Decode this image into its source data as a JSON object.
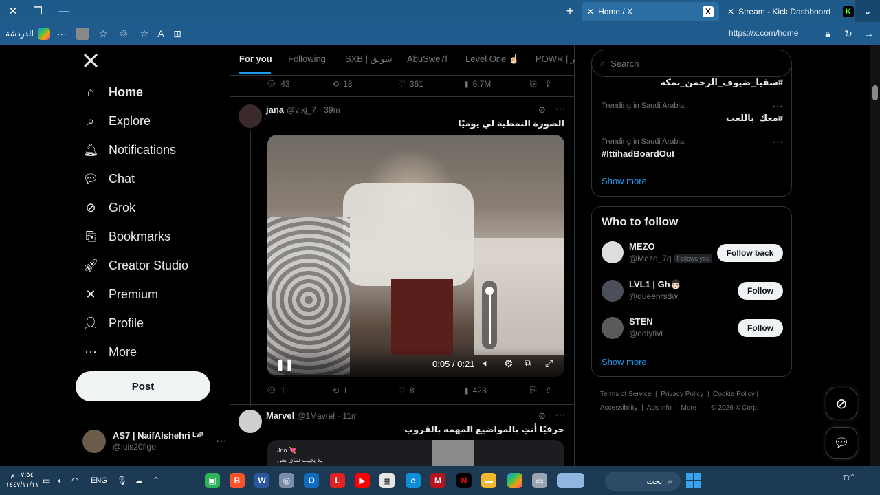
{
  "browser": {
    "tabs": [
      {
        "title": "Home / X",
        "active": true
      },
      {
        "title": "Stream - Kick Dashboard",
        "active": false
      }
    ],
    "address": "https://x.com/home",
    "copilot_label": "الدردشة"
  },
  "sidebar": {
    "nav": [
      {
        "label": "Home",
        "icon": "home-icon"
      },
      {
        "label": "Explore",
        "icon": "search-icon"
      },
      {
        "label": "Notifications",
        "icon": "bell-icon"
      },
      {
        "label": "Chat",
        "icon": "chat-icon"
      },
      {
        "label": "Grok",
        "icon": "grok-icon"
      },
      {
        "label": "Bookmarks",
        "icon": "bookmark-icon"
      },
      {
        "label": "Creator Studio",
        "icon": "rocket-icon"
      },
      {
        "label": "Premium",
        "icon": "x-logo-icon"
      },
      {
        "label": "Profile",
        "icon": "person-icon"
      },
      {
        "label": "More",
        "icon": "more-circle-icon"
      }
    ],
    "post_label": "Post",
    "account": {
      "name": "AS7 | NaifAlshehri ᴸᵛˡ¹",
      "handle": "@luis20figo"
    }
  },
  "feed_tabs": [
    "For you",
    "Following",
    "SXB | شونق",
    "AbuSwe7l",
    "Level One ☝🏻",
    "POWR | ر"
  ],
  "top_post_stats": {
    "replies": "43",
    "reposts": "18",
    "likes": "361",
    "views": "6.7M"
  },
  "post1": {
    "name": "jana",
    "handle": "@vixj_7",
    "time": "· 39m",
    "text": "الصورة النمطية لي يوميًا",
    "video": {
      "current": "0:05",
      "separator": " / ",
      "duration": "0:21",
      "volume": 0.92
    },
    "stats": {
      "replies": "1",
      "reposts": "1",
      "likes": "8",
      "views": "423"
    }
  },
  "post2": {
    "name": "Marvel",
    "handle": "@1Mavrel",
    "time": "· 11m",
    "text": "حرفيًا أنتِ بالمواضيع المهمه بالقروب",
    "preview_name": "Jno 💘",
    "preview_text": "يلا يجيب شاي بس"
  },
  "search": {
    "placeholder": "Search"
  },
  "trends": [
    {
      "meta": "",
      "tag": "#سقيا_ضيوف_الرحمن_بمكه"
    },
    {
      "meta": "Trending in Saudi Arabia",
      "tag": "#معك_باللعب"
    },
    {
      "meta": "Trending in Saudi Arabia",
      "tag": "#IttihadBoardOut"
    }
  ],
  "trends_show_more": "Show more",
  "who_to_follow": {
    "title": "Who to follow",
    "users": [
      {
        "name": "MEZO",
        "handle": "@Mezo_7q",
        "badge": "Follows you",
        "button": "Follow back"
      },
      {
        "name": "LVL1 | Gh👨🏻",
        "handle": "@queenrsdw",
        "badge": "",
        "button": "Follow"
      },
      {
        "name": "STEN",
        "handle": "@onlyfivi",
        "badge": "",
        "button": "Follow"
      }
    ],
    "show_more": "Show more"
  },
  "footer": {
    "links": [
      "Terms of Service",
      "Privacy Policy",
      "Cookie Policy",
      "Accessibility",
      "Ads info",
      "More ···"
    ],
    "copyright": "© 2026 X Corp."
  },
  "taskbar": {
    "time": "٠٧:٥٤ م",
    "date": "١٤٤٧/١١/١١",
    "lang": "ENG",
    "search_label": "بحث",
    "temp": "٣٢°"
  }
}
